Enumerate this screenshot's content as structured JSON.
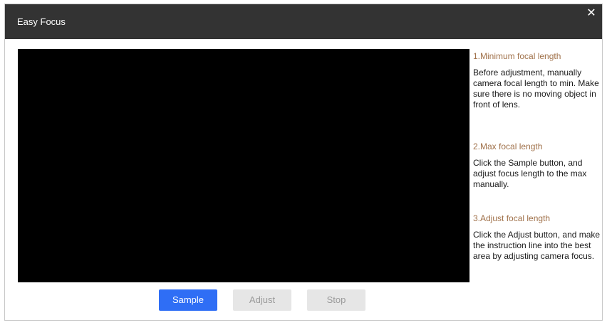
{
  "dialog": {
    "title": "Easy Focus",
    "close_glyph": "✕",
    "close_icon": "close-icon",
    "colors": {
      "titlebar": "#333333",
      "step_title": "#a0714a",
      "primary_button": "#2f6ef5",
      "disabled_button": "#e6e6e6"
    }
  },
  "steps": [
    {
      "title": "1.Minimum focal length",
      "text": "Before adjustment, manually camera focal length to min. Make sure there is no moving object in front of lens."
    },
    {
      "title": "2.Max focal length",
      "text": "Click the Sample button, and adjust focus length to the max manually."
    },
    {
      "title": "3.Adjust focal length",
      "text": "Click the Adjust button, and make the instruction line into the best area by adjusting camera focus."
    }
  ],
  "buttons": {
    "sample": "Sample",
    "adjust": "Adjust",
    "stop": "Stop"
  }
}
